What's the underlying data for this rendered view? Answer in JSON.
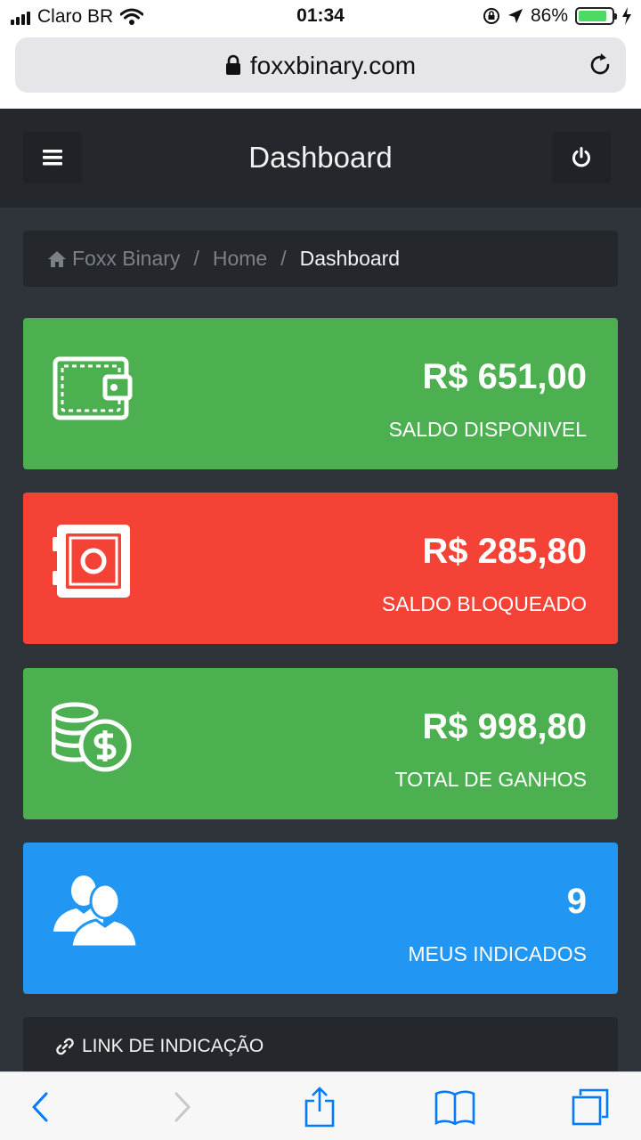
{
  "status_bar": {
    "carrier": "Claro BR",
    "time": "01:34",
    "battery_percent": "86%",
    "battery_level": 0.86
  },
  "browser": {
    "url": "foxxbinary.com"
  },
  "header": {
    "title": "Dashboard"
  },
  "breadcrumb": {
    "items": [
      "Foxx Binary",
      "Home",
      "Dashboard"
    ]
  },
  "cards": [
    {
      "value": "R$ 651,00",
      "label": "SALDO DISPONIVEL",
      "color": "#4caf50",
      "icon": "wallet-icon"
    },
    {
      "value": "R$ 285,80",
      "label": "SALDO BLOQUEADO",
      "color": "#f44336",
      "icon": "safe-icon"
    },
    {
      "value": "R$ 998,80",
      "label": "TOTAL DE GANHOS",
      "color": "#4caf50",
      "icon": "coins-icon"
    },
    {
      "value": "9",
      "label": "MEUS INDICADOS",
      "color": "#2196f3",
      "icon": "users-icon"
    }
  ],
  "link_panel": {
    "title": "LINK DE INDICAÇÃO"
  },
  "colors": {
    "page_bg": "#2f343a",
    "header_bg": "#24282d",
    "accent_blue": "#007aff"
  }
}
